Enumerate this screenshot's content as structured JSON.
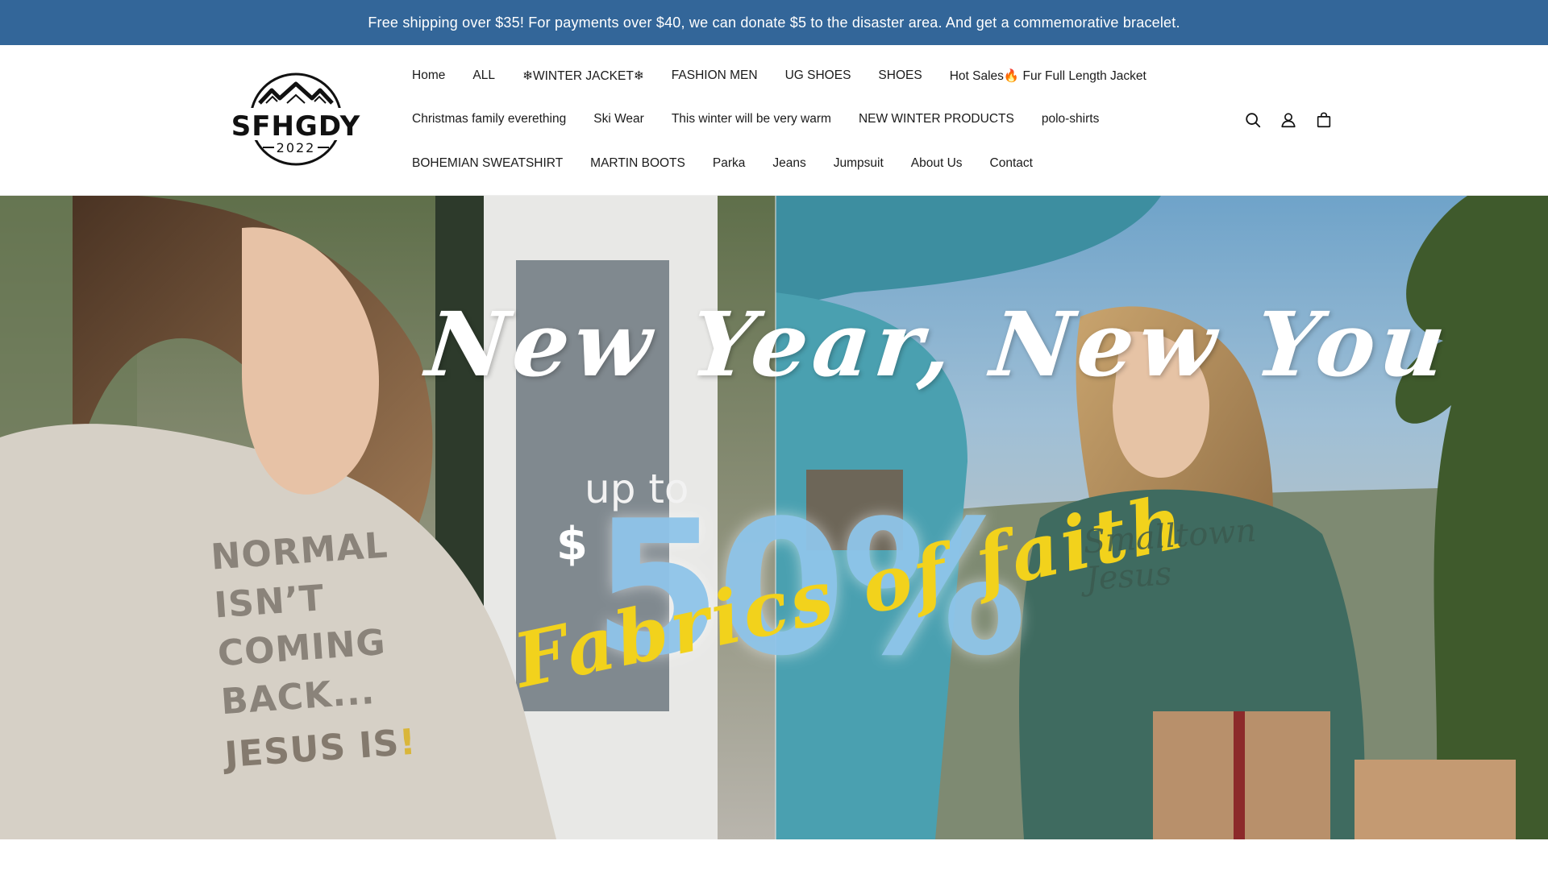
{
  "announcement": {
    "text": "Free shipping over $35! For payments over $40, we can donate $5 to the disaster area. And get a commemorative bracelet.",
    "bg_color": "#336699"
  },
  "logo": {
    "brand": "SFHGDY",
    "year": "2022"
  },
  "nav": {
    "row1": [
      "Home",
      "ALL",
      "❄WINTER JACKET❄",
      "FASHION MEN",
      "UG SHOES",
      "SHOES",
      "Hot Sales🔥 Fur Full Length Jacket"
    ],
    "row2": [
      "Christmas family everething",
      "Ski Wear",
      "This winter will be very warm",
      "NEW WINTER PRODUCTS",
      "polo-shirts"
    ],
    "row3": [
      "BOHEMIAN SWEATSHIRT",
      "MARTIN BOOTS",
      "Parka",
      "Jeans",
      "Jumpsuit",
      "About Us",
      "Contact"
    ]
  },
  "header_icons": [
    "search-icon",
    "account-icon",
    "cart-icon"
  ],
  "hero": {
    "title": "New Year, New You",
    "upto": "up to",
    "dollar": "$",
    "percent": "50%",
    "script": "Fabrics of faith",
    "shirt_lines": [
      "NORMAL",
      "ISN’T",
      "COMING",
      "BACK..."
    ],
    "shirt_jesus": "JESUS IS",
    "shirt_bang": "!",
    "shirt2_lines": [
      "Smalltown",
      "Jesus"
    ],
    "accent_yellow": "#f2d21c",
    "accent_blue": "#8fc5ea"
  }
}
